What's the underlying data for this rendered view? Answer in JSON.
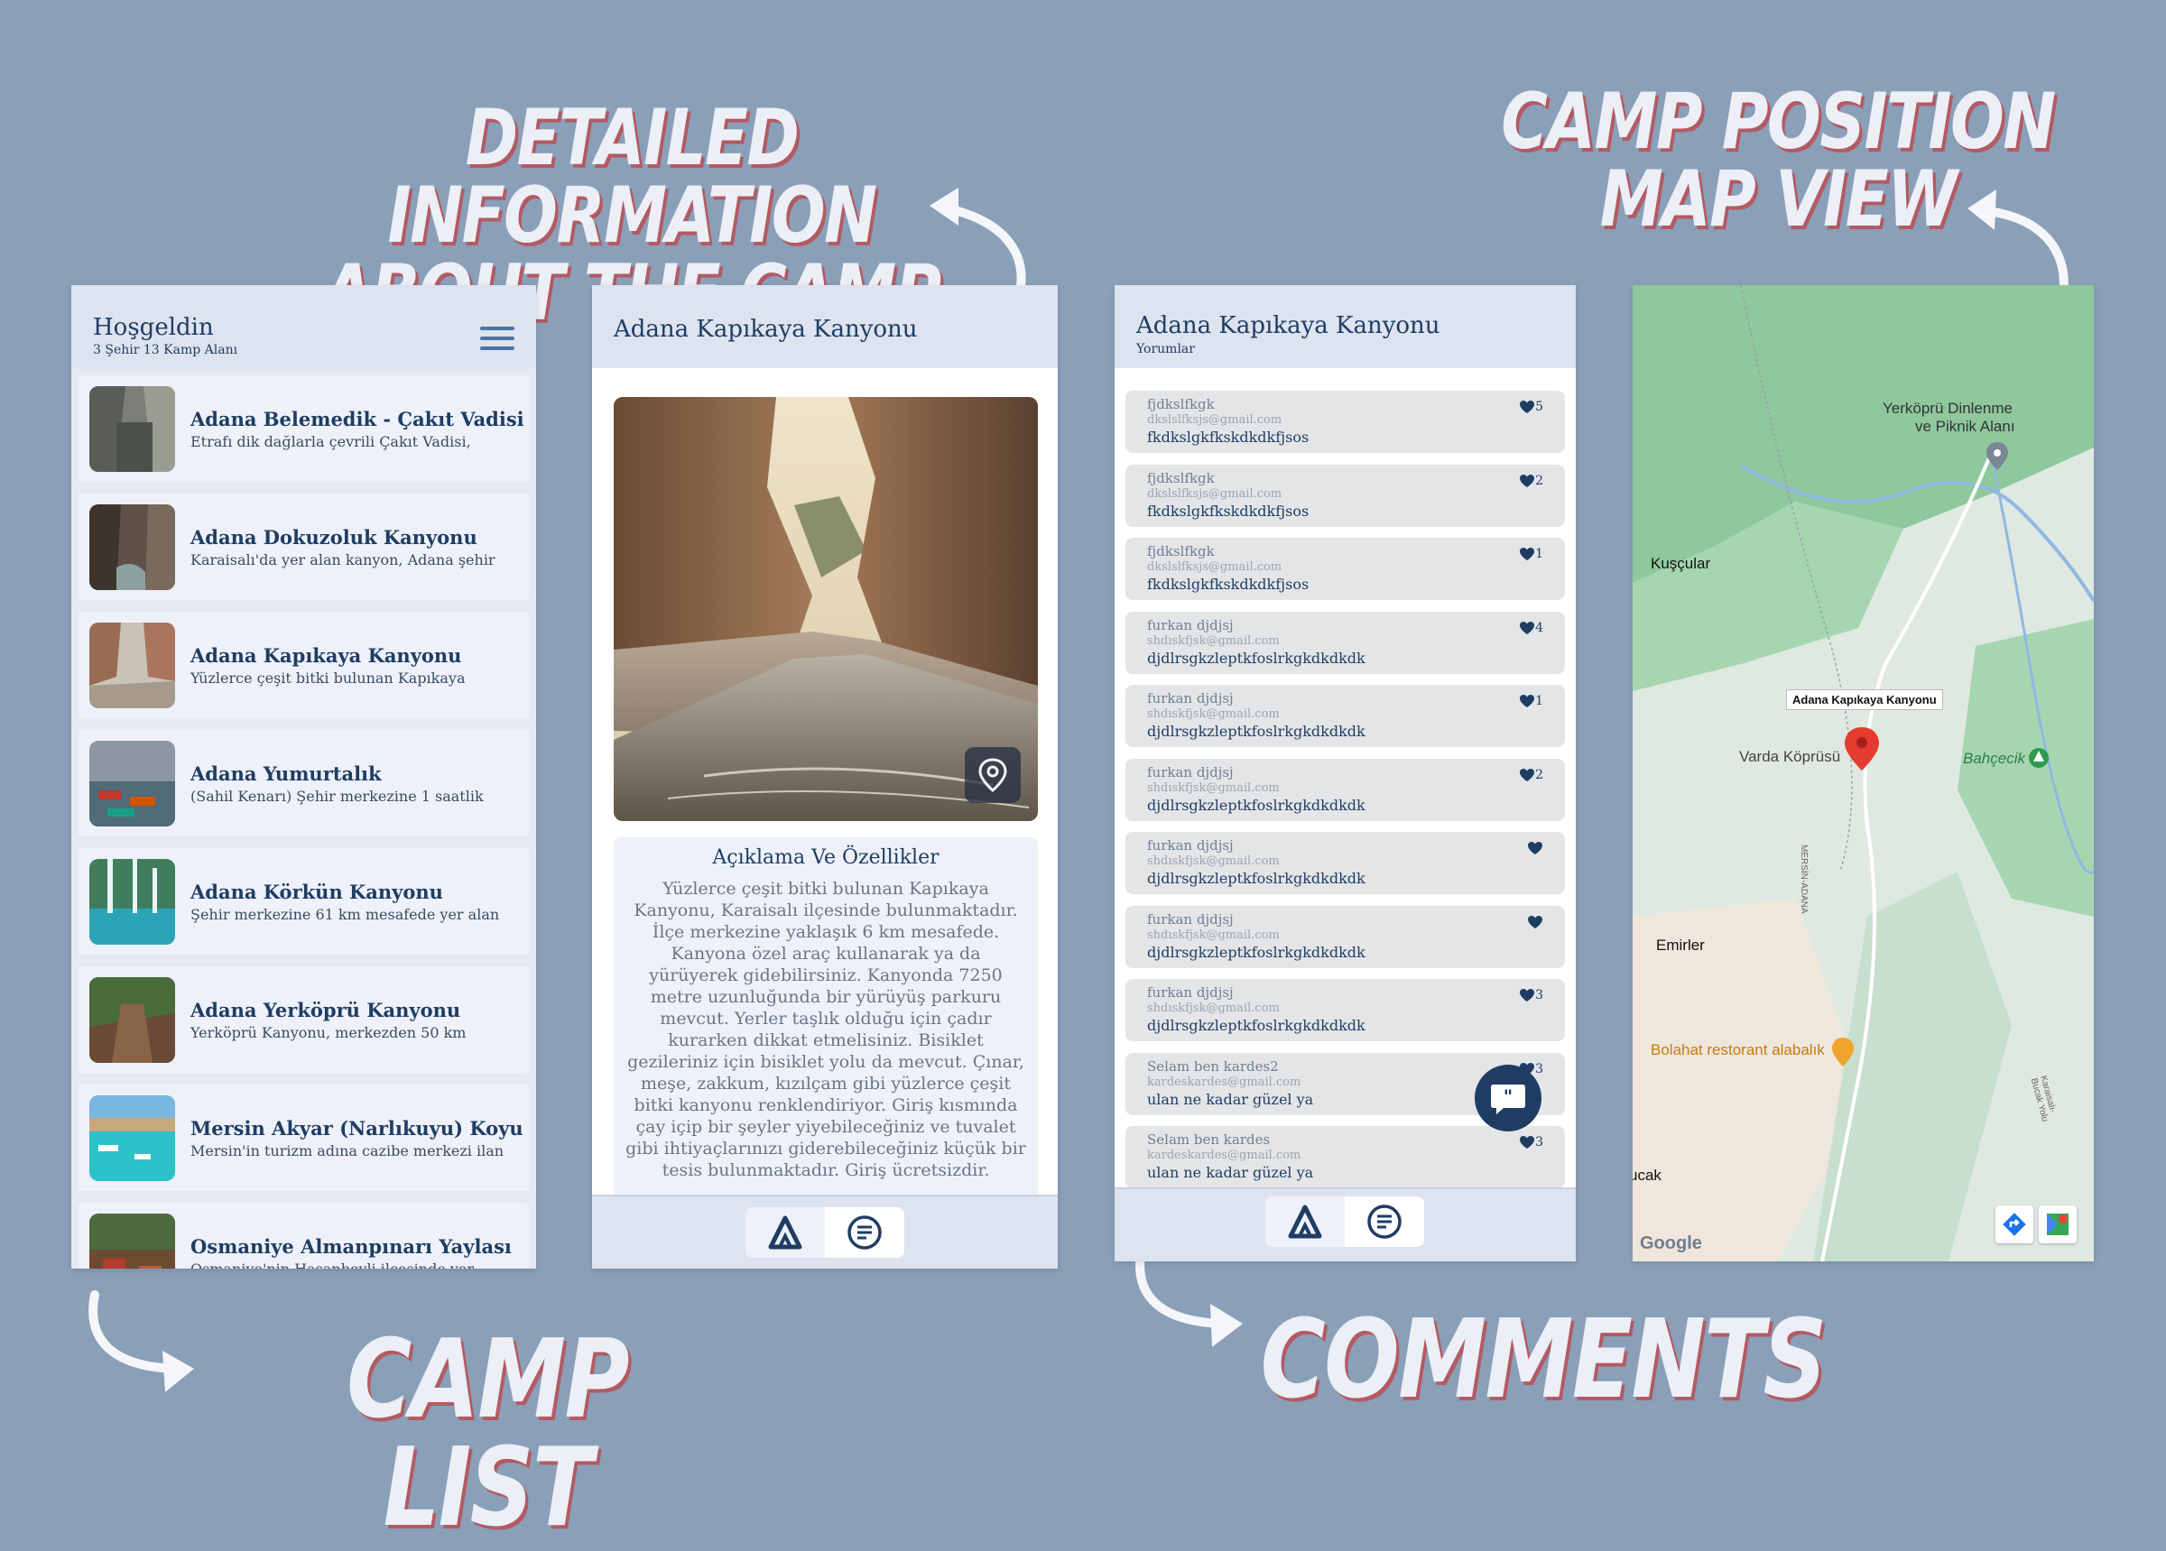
{
  "captions": {
    "detail": [
      "DETAILED INFORMATION",
      "ABOUT THE CAMP"
    ],
    "map": [
      "CAMP POSITION",
      "MAP VIEW"
    ],
    "list": "CAMP LIST",
    "comments": "COMMENTS"
  },
  "colors": {
    "background": "#8a9fb8",
    "primary": "#1f3d63",
    "header": "#dde3ef",
    "card": "#eef1f9",
    "caption": "#eceff6",
    "caption_shadow": "#b35a63"
  },
  "list_screen": {
    "title": "Hoşgeldin",
    "subtitle": "3 Şehir 13 Kamp Alanı",
    "menu_icon": "hamburger-menu-icon",
    "camps": [
      {
        "name": "Adana Belemedik - Çakıt Vadisi",
        "desc": "Etrafı dik dağlarla çevrili Çakıt Vadisi,"
      },
      {
        "name": "Adana Dokuzoluk Kanyonu",
        "desc": "Karaisalı'da yer alan kanyon, Adana şehir"
      },
      {
        "name": "Adana Kapıkaya Kanyonu",
        "desc": "Yüzlerce çeşit bitki bulunan Kapıkaya"
      },
      {
        "name": "Adana Yumurtalık",
        "desc": "(Sahil Kenarı) Şehir merkezine 1 saatlik"
      },
      {
        "name": "Adana Körkün Kanyonu",
        "desc": "Şehir merkezine 61 km mesafede yer alan"
      },
      {
        "name": "Adana Yerköprü Kanyonu",
        "desc": "Yerköprü Kanyonu, merkezden 50 km"
      },
      {
        "name": "Mersin Akyar (Narlıkuyu) Koyu",
        "desc": "Mersin'in turizm adına cazibe merkezi ilan"
      },
      {
        "name": "Osmaniye Almanpınarı Yaylası",
        "desc": "Osmaniye'nin Hasanbeyli ilçesinde yer"
      }
    ]
  },
  "detail_screen": {
    "title": "Adana Kapıkaya Kanyonu",
    "section_title": "Açıklama Ve Özellikler",
    "description": "Yüzlerce çeşit bitki bulunan Kapıkaya Kanyonu, Karaisalı ilçesinde bulunmaktadır. İlçe merkezine yaklaşık 6 km mesafede. Kanyona özel araç kullanarak ya da yürüyerek gidebilirsiniz. Kanyonda 7250 metre uzunluğunda bir yürüyüş parkuru mevcut. Yerler taşlık olduğu için çadır kurarken dikkat etmelisiniz. Bisiklet gezileriniz için bisiklet yolu da mevcut. Çınar, meşe, zakkum, kızılçam gibi yüzlerce çeşit bitki kanyonu renklendiriyor. Giriş kısmında çay içip bir şeyler yiyebileceğiniz ve tuvalet gibi ihtiyaçlarınızı giderebileceğiniz küçük bir tesis bulunmaktadır. Giriş ücretsizdir.",
    "location_icon": "map-pin-icon",
    "nav": [
      "camp-icon",
      "comments-icon"
    ]
  },
  "comments_screen": {
    "title": "Adana Kapıkaya Kanyonu",
    "subtitle": "Yorumlar",
    "comments": [
      {
        "name": "fjdkslfkgk",
        "email": "dkslslfksjs@gmail.com",
        "text": "fkdkslgkfkskdkdkfjsos",
        "likes": "5"
      },
      {
        "name": "fjdkslfkgk",
        "email": "dkslslfksjs@gmail.com",
        "text": "fkdkslgkfkskdkdkfjsos",
        "likes": "2"
      },
      {
        "name": "fjdkslfkgk",
        "email": "dkslslfksjs@gmail.com",
        "text": "fkdkslgkfkskdkdkfjsos",
        "likes": "1"
      },
      {
        "name": "furkan djdjsj",
        "email": "shdıskfjsk@gmail.com",
        "text": "djdlrsgkzleptkfoslrkgkdkdkdk",
        "likes": "4"
      },
      {
        "name": "furkan djdjsj",
        "email": "shdıskfjsk@gmail.com",
        "text": "djdlrsgkzleptkfoslrkgkdkdkdk",
        "likes": "1"
      },
      {
        "name": "furkan djdjsj",
        "email": "shdıskfjsk@gmail.com",
        "text": "djdlrsgkzleptkfoslrkgkdkdkdk",
        "likes": "2"
      },
      {
        "name": "furkan djdjsj",
        "email": "shdıskfjsk@gmail.com",
        "text": "djdlrsgkzleptkfoslrkgkdkdkdk",
        "likes": ""
      },
      {
        "name": "furkan djdjsj",
        "email": "shdıskfjsk@gmail.com",
        "text": "djdlrsgkzleptkfoslrkgkdkdkdk",
        "likes": ""
      },
      {
        "name": "furkan djdjsj",
        "email": "shdıskfjsk@gmail.com",
        "text": "djdlrsgkzleptkfoslrkgkdkdkdk",
        "likes": "3"
      },
      {
        "name": "Selam ben kardes2",
        "email": "kardeskardes@gmail.com",
        "text": "ulan ne kadar güzel ya",
        "likes": "3"
      },
      {
        "name": "Selam ben kardes",
        "email": "kardeskardes@gmail.com",
        "text": "ulan ne kadar güzel ya",
        "likes": "3"
      }
    ],
    "fab_icon": "add-comment-icon",
    "nav": [
      "camp-icon",
      "comments-icon"
    ]
  },
  "map_screen": {
    "labels": [
      {
        "text": "Yerköprü Dinlenme"
      },
      {
        "text": "ve Piknik Alanı"
      },
      {
        "text": "Kuşçular"
      },
      {
        "text": "Varda Köprüsü"
      },
      {
        "text": "Bahçecik"
      },
      {
        "text": "Emirler"
      },
      {
        "text": "Bolahat restorant alabalık"
      },
      {
        "text": "ucak"
      },
      {
        "text": "MERSİN-ADANA"
      },
      {
        "text": "Karaisalı-Bucak Yolu"
      }
    ],
    "tooltip": "Adana Kapıkaya Kanyonu",
    "google": "Google",
    "buttons": [
      "directions-icon",
      "google-maps-icon"
    ]
  }
}
